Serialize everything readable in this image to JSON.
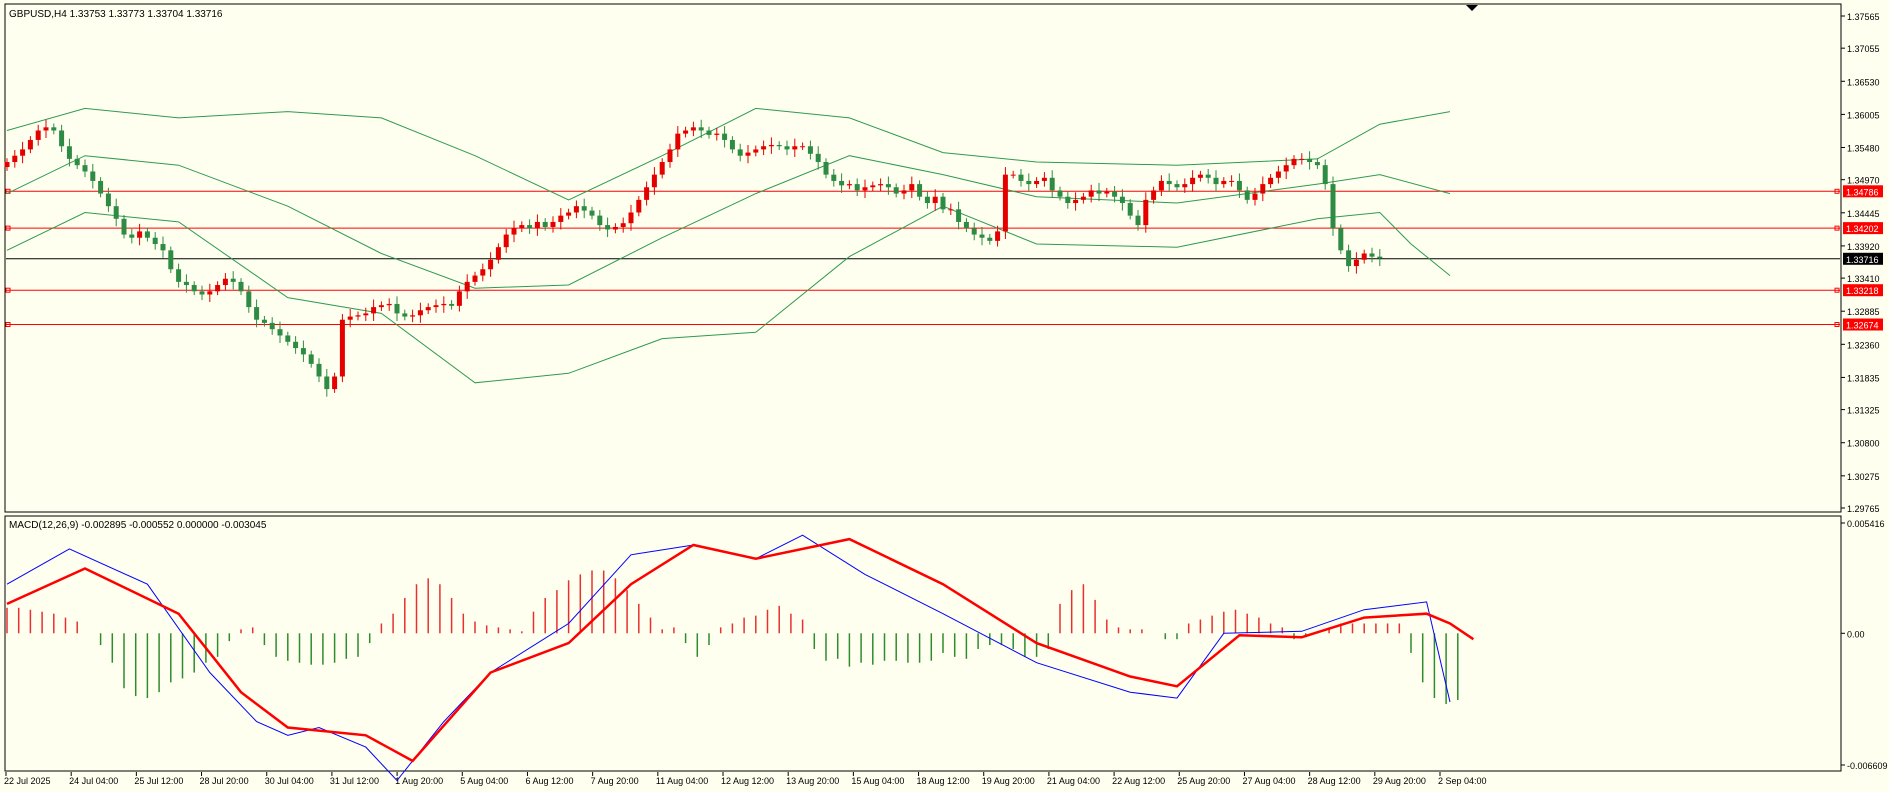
{
  "symbol_header": "GBPUSD,H4  1.33753 1.33773 1.33704 1.33716",
  "macd_header": "MACD(12,26,9) -0.002895 -0.000552 0.000000 -0.003045",
  "colors": {
    "background": "#fffff0",
    "bull_candle": "#e50000",
    "bear_candle": "#2e8b44",
    "bollinger": "#2e9a50",
    "hlines": "#ff0000",
    "price_line": "#000000",
    "macd_line": "#0000ff",
    "signal_line": "#ff0000",
    "hist_pos": "#e83030",
    "hist_neg": "#2e8b2e"
  },
  "price_axis": {
    "ylim": [
      1.29765,
      1.37565
    ],
    "ticks": [
      "1.37565",
      "1.37055",
      "1.36530",
      "1.36005",
      "1.35480",
      "1.34970",
      "1.34445",
      "1.33920",
      "1.33410",
      "1.32885",
      "1.32360",
      "1.31835",
      "1.31325",
      "1.30800",
      "1.30275",
      "1.29765"
    ]
  },
  "macd_axis": {
    "ylim": [
      -0.006609,
      0.005416
    ],
    "ticks": [
      "0.005416",
      "0.00",
      "-0.006609"
    ]
  },
  "price_labels": [
    {
      "text": "1.34786",
      "value": 1.34786,
      "color": "#ff0000"
    },
    {
      "text": "1.34202",
      "value": 1.34202,
      "color": "#ff0000"
    },
    {
      "text": "1.33716",
      "value": 1.33716,
      "color": "#000000"
    },
    {
      "text": "1.33218",
      "value": 1.33218,
      "color": "#ff0000"
    },
    {
      "text": "1.32674",
      "value": 1.32674,
      "color": "#ff0000"
    }
  ],
  "x_labels": [
    "22 Jul 2025",
    "24 Jul 04:00",
    "25 Jul 12:00",
    "28 Jul 20:00",
    "30 Jul 04:00",
    "31 Jul 12:00",
    "1 Aug 20:00",
    "5 Aug 04:00",
    "6 Aug 12:00",
    "7 Aug 20:00",
    "11 Aug 04:00",
    "12 Aug 12:00",
    "13 Aug 20:00",
    "15 Aug 04:00",
    "18 Aug 12:00",
    "19 Aug 20:00",
    "21 Aug 04:00",
    "22 Aug 12:00",
    "25 Aug 20:00",
    "27 Aug 04:00",
    "28 Aug 12:00",
    "29 Aug 20:00",
    "2 Sep 04:00"
  ],
  "chart_data": {
    "type": "candlestick",
    "bar_period": "H4",
    "close_path": [
      1.3525,
      1.3535,
      1.3545,
      1.356,
      1.3575,
      1.358,
      1.3575,
      1.355,
      1.353,
      1.352,
      1.351,
      1.3495,
      1.3475,
      1.3455,
      1.3435,
      1.341,
      1.3405,
      1.3415,
      1.3405,
      1.3395,
      1.3385,
      1.3355,
      1.3335,
      1.333,
      1.332,
      1.3315,
      1.332,
      1.333,
      1.334,
      1.3335,
      1.332,
      1.3295,
      1.3275,
      1.327,
      1.326,
      1.325,
      1.324,
      1.323,
      1.322,
      1.3205,
      1.3185,
      1.3165,
      1.3185,
      1.3275,
      1.328,
      1.3282,
      1.3285,
      1.3295,
      1.3298,
      1.33,
      1.3285,
      1.328,
      1.3282,
      1.329,
      1.3295,
      1.3298,
      1.33,
      1.3297,
      1.332,
      1.3335,
      1.3345,
      1.3355,
      1.337,
      1.339,
      1.341,
      1.342,
      1.3425,
      1.342,
      1.343,
      1.3422,
      1.343,
      1.344,
      1.3445,
      1.3455,
      1.3448,
      1.344,
      1.3425,
      1.3418,
      1.3422,
      1.3428,
      1.3445,
      1.3465,
      1.3485,
      1.3505,
      1.3525,
      1.3545,
      1.357,
      1.3575,
      1.358,
      1.3575,
      1.3568,
      1.357,
      1.356,
      1.3545,
      1.3535,
      1.354,
      1.3545,
      1.355,
      1.3552,
      1.355,
      1.3545,
      1.355,
      1.355,
      1.3538,
      1.3525,
      1.3505,
      1.3495,
      1.3488,
      1.349,
      1.348,
      1.3485,
      1.3488,
      1.349,
      1.3485,
      1.3475,
      1.348,
      1.349,
      1.347,
      1.346,
      1.347,
      1.345,
      1.345,
      1.343,
      1.342,
      1.341,
      1.3405,
      1.34,
      1.3415,
      1.3505,
      1.3505,
      1.3495,
      1.349,
      1.3495,
      1.35,
      1.348,
      1.347,
      1.346,
      1.3465,
      1.347,
      1.348,
      1.3475,
      1.3478,
      1.347,
      1.346,
      1.344,
      1.3425,
      1.3465,
      1.348,
      1.3495,
      1.349,
      1.3485,
      1.349,
      1.35,
      1.3505,
      1.35,
      1.349,
      1.3495,
      1.3495,
      1.348,
      1.3465,
      1.3475,
      1.349,
      1.35,
      1.351,
      1.352,
      1.353,
      1.353,
      1.3525,
      1.352,
      1.349,
      1.342,
      1.3385,
      1.336,
      1.337,
      1.338,
      1.3375,
      1.3372
    ],
    "candles_note": "one H4 bar per close_path value; open = previous close",
    "bollinger_bands": {
      "period_label": "",
      "upper": [
        [
          0,
          1.3575
        ],
        [
          10,
          1.361
        ],
        [
          22,
          1.3595
        ],
        [
          36,
          1.3605
        ],
        [
          48,
          1.3595
        ],
        [
          60,
          1.3535
        ],
        [
          72,
          1.3465
        ],
        [
          84,
          1.3535
        ],
        [
          96,
          1.361
        ],
        [
          108,
          1.3595
        ],
        [
          120,
          1.354
        ],
        [
          132,
          1.3525
        ],
        [
          150,
          1.352
        ],
        [
          168,
          1.353
        ],
        [
          176,
          1.3585
        ],
        [
          185,
          1.3605
        ]
      ],
      "middle": [
        [
          0,
          1.3475
        ],
        [
          10,
          1.3535
        ],
        [
          22,
          1.352
        ],
        [
          36,
          1.3455
        ],
        [
          48,
          1.338
        ],
        [
          60,
          1.3325
        ],
        [
          72,
          1.333
        ],
        [
          84,
          1.3405
        ],
        [
          96,
          1.3475
        ],
        [
          108,
          1.3535
        ],
        [
          120,
          1.3505
        ],
        [
          132,
          1.347
        ],
        [
          150,
          1.346
        ],
        [
          168,
          1.349
        ],
        [
          176,
          1.3505
        ],
        [
          185,
          1.3475
        ]
      ],
      "lower": [
        [
          0,
          1.3385
        ],
        [
          10,
          1.3445
        ],
        [
          22,
          1.343
        ],
        [
          36,
          1.331
        ],
        [
          48,
          1.3285
        ],
        [
          60,
          1.3175
        ],
        [
          72,
          1.319
        ],
        [
          84,
          1.3245
        ],
        [
          96,
          1.3255
        ],
        [
          108,
          1.3375
        ],
        [
          120,
          1.3455
        ],
        [
          132,
          1.3395
        ],
        [
          150,
          1.339
        ],
        [
          168,
          1.3435
        ],
        [
          176,
          1.3445
        ],
        [
          180,
          1.3395
        ],
        [
          185,
          1.3345
        ]
      ]
    },
    "horizontal_lines": [
      1.34786,
      1.34202,
      1.33218,
      1.32674
    ],
    "current_price": 1.33716,
    "macd": {
      "macd_line": [
        [
          0,
          0.0025
        ],
        [
          8,
          0.0043
        ],
        [
          18,
          0.0025
        ],
        [
          26,
          -0.002
        ],
        [
          32,
          -0.0045
        ],
        [
          36,
          -0.0052
        ],
        [
          40,
          -0.0048
        ],
        [
          46,
          -0.0058
        ],
        [
          50,
          -0.0075
        ],
        [
          56,
          -0.0045
        ],
        [
          62,
          -0.002
        ],
        [
          72,
          0.0005
        ],
        [
          80,
          0.004
        ],
        [
          88,
          0.0045
        ],
        [
          96,
          0.0038
        ],
        [
          102,
          0.005
        ],
        [
          110,
          0.003
        ],
        [
          120,
          0.001
        ],
        [
          132,
          -0.0015
        ],
        [
          144,
          -0.003
        ],
        [
          150,
          -0.0033
        ],
        [
          156,
          0.0
        ],
        [
          166,
          0.0001
        ],
        [
          174,
          0.0012
        ],
        [
          182,
          0.0016
        ],
        [
          185,
          -0.0035
        ]
      ],
      "signal_line": [
        [
          0,
          0.0015
        ],
        [
          10,
          0.0033
        ],
        [
          22,
          0.001
        ],
        [
          30,
          -0.003
        ],
        [
          36,
          -0.0048
        ],
        [
          46,
          -0.0052
        ],
        [
          52,
          -0.0065
        ],
        [
          62,
          -0.002
        ],
        [
          72,
          -0.0005
        ],
        [
          80,
          0.0025
        ],
        [
          88,
          0.0045
        ],
        [
          96,
          0.0038
        ],
        [
          108,
          0.0048
        ],
        [
          120,
          0.0025
        ],
        [
          132,
          -0.0005
        ],
        [
          144,
          -0.0022
        ],
        [
          150,
          -0.0027
        ],
        [
          158,
          -0.0001
        ],
        [
          166,
          -0.0002
        ],
        [
          174,
          0.0008
        ],
        [
          182,
          0.001
        ],
        [
          185,
          0.0005
        ],
        [
          188,
          -0.0003
        ]
      ],
      "histogram": [
        0.0013,
        0.0013,
        0.0012,
        0.0011,
        0.001,
        0.0008,
        0.0006,
        0.0,
        -0.0006,
        -0.0015,
        -0.0028,
        -0.0032,
        -0.0033,
        -0.003,
        -0.0025,
        -0.0023,
        -0.002,
        -0.0015,
        -0.0012,
        -0.0004,
        0.0002,
        0.0003,
        -0.0006,
        -0.0012,
        -0.0014,
        -0.0015,
        -0.0016,
        -0.0016,
        -0.0015,
        -0.0013,
        -0.0012,
        -0.0005,
        0.0005,
        0.001,
        0.0018,
        0.0025,
        0.0028,
        0.0025,
        0.0018,
        0.001,
        0.0006,
        0.0004,
        0.0003,
        0.0002,
        0.0001,
        0.0011,
        0.0018,
        0.0022,
        0.0027,
        0.003,
        0.0032,
        0.0032,
        0.0028,
        0.0022,
        0.0015,
        0.0008,
        0.0002,
        0.0003,
        -0.0005,
        -0.0012,
        -0.0006,
        0.0003,
        0.0005,
        0.0008,
        0.0009,
        0.0012,
        0.0014,
        0.001,
        0.0007,
        -0.0008,
        -0.0014,
        -0.0013,
        -0.0017,
        -0.0015,
        -0.0016,
        -0.0014,
        -0.0014,
        -0.0015,
        -0.0015,
        -0.0014,
        -0.001,
        -0.0012,
        -0.0013,
        -0.0008,
        -0.0006,
        -0.0006,
        -0.0008,
        -0.0012,
        -0.0012,
        -0.0008,
        0.0015,
        0.0022,
        0.0025,
        0.0017,
        0.0007,
        0.0003,
        0.0002,
        0.0002,
        0.0,
        -0.0003,
        -0.0003,
        0.0005,
        0.0007,
        0.0009,
        0.0011,
        0.0012,
        0.001,
        0.0008,
        0.0005,
        0.0003,
        -0.0003,
        -0.0002,
        0.0001,
        0.0003,
        0.0005,
        0.0005,
        0.0005,
        0.0005,
        0.0005,
        0.0005,
        -0.001,
        -0.0025,
        -0.0033,
        -0.0036,
        -0.0034
      ]
    }
  }
}
